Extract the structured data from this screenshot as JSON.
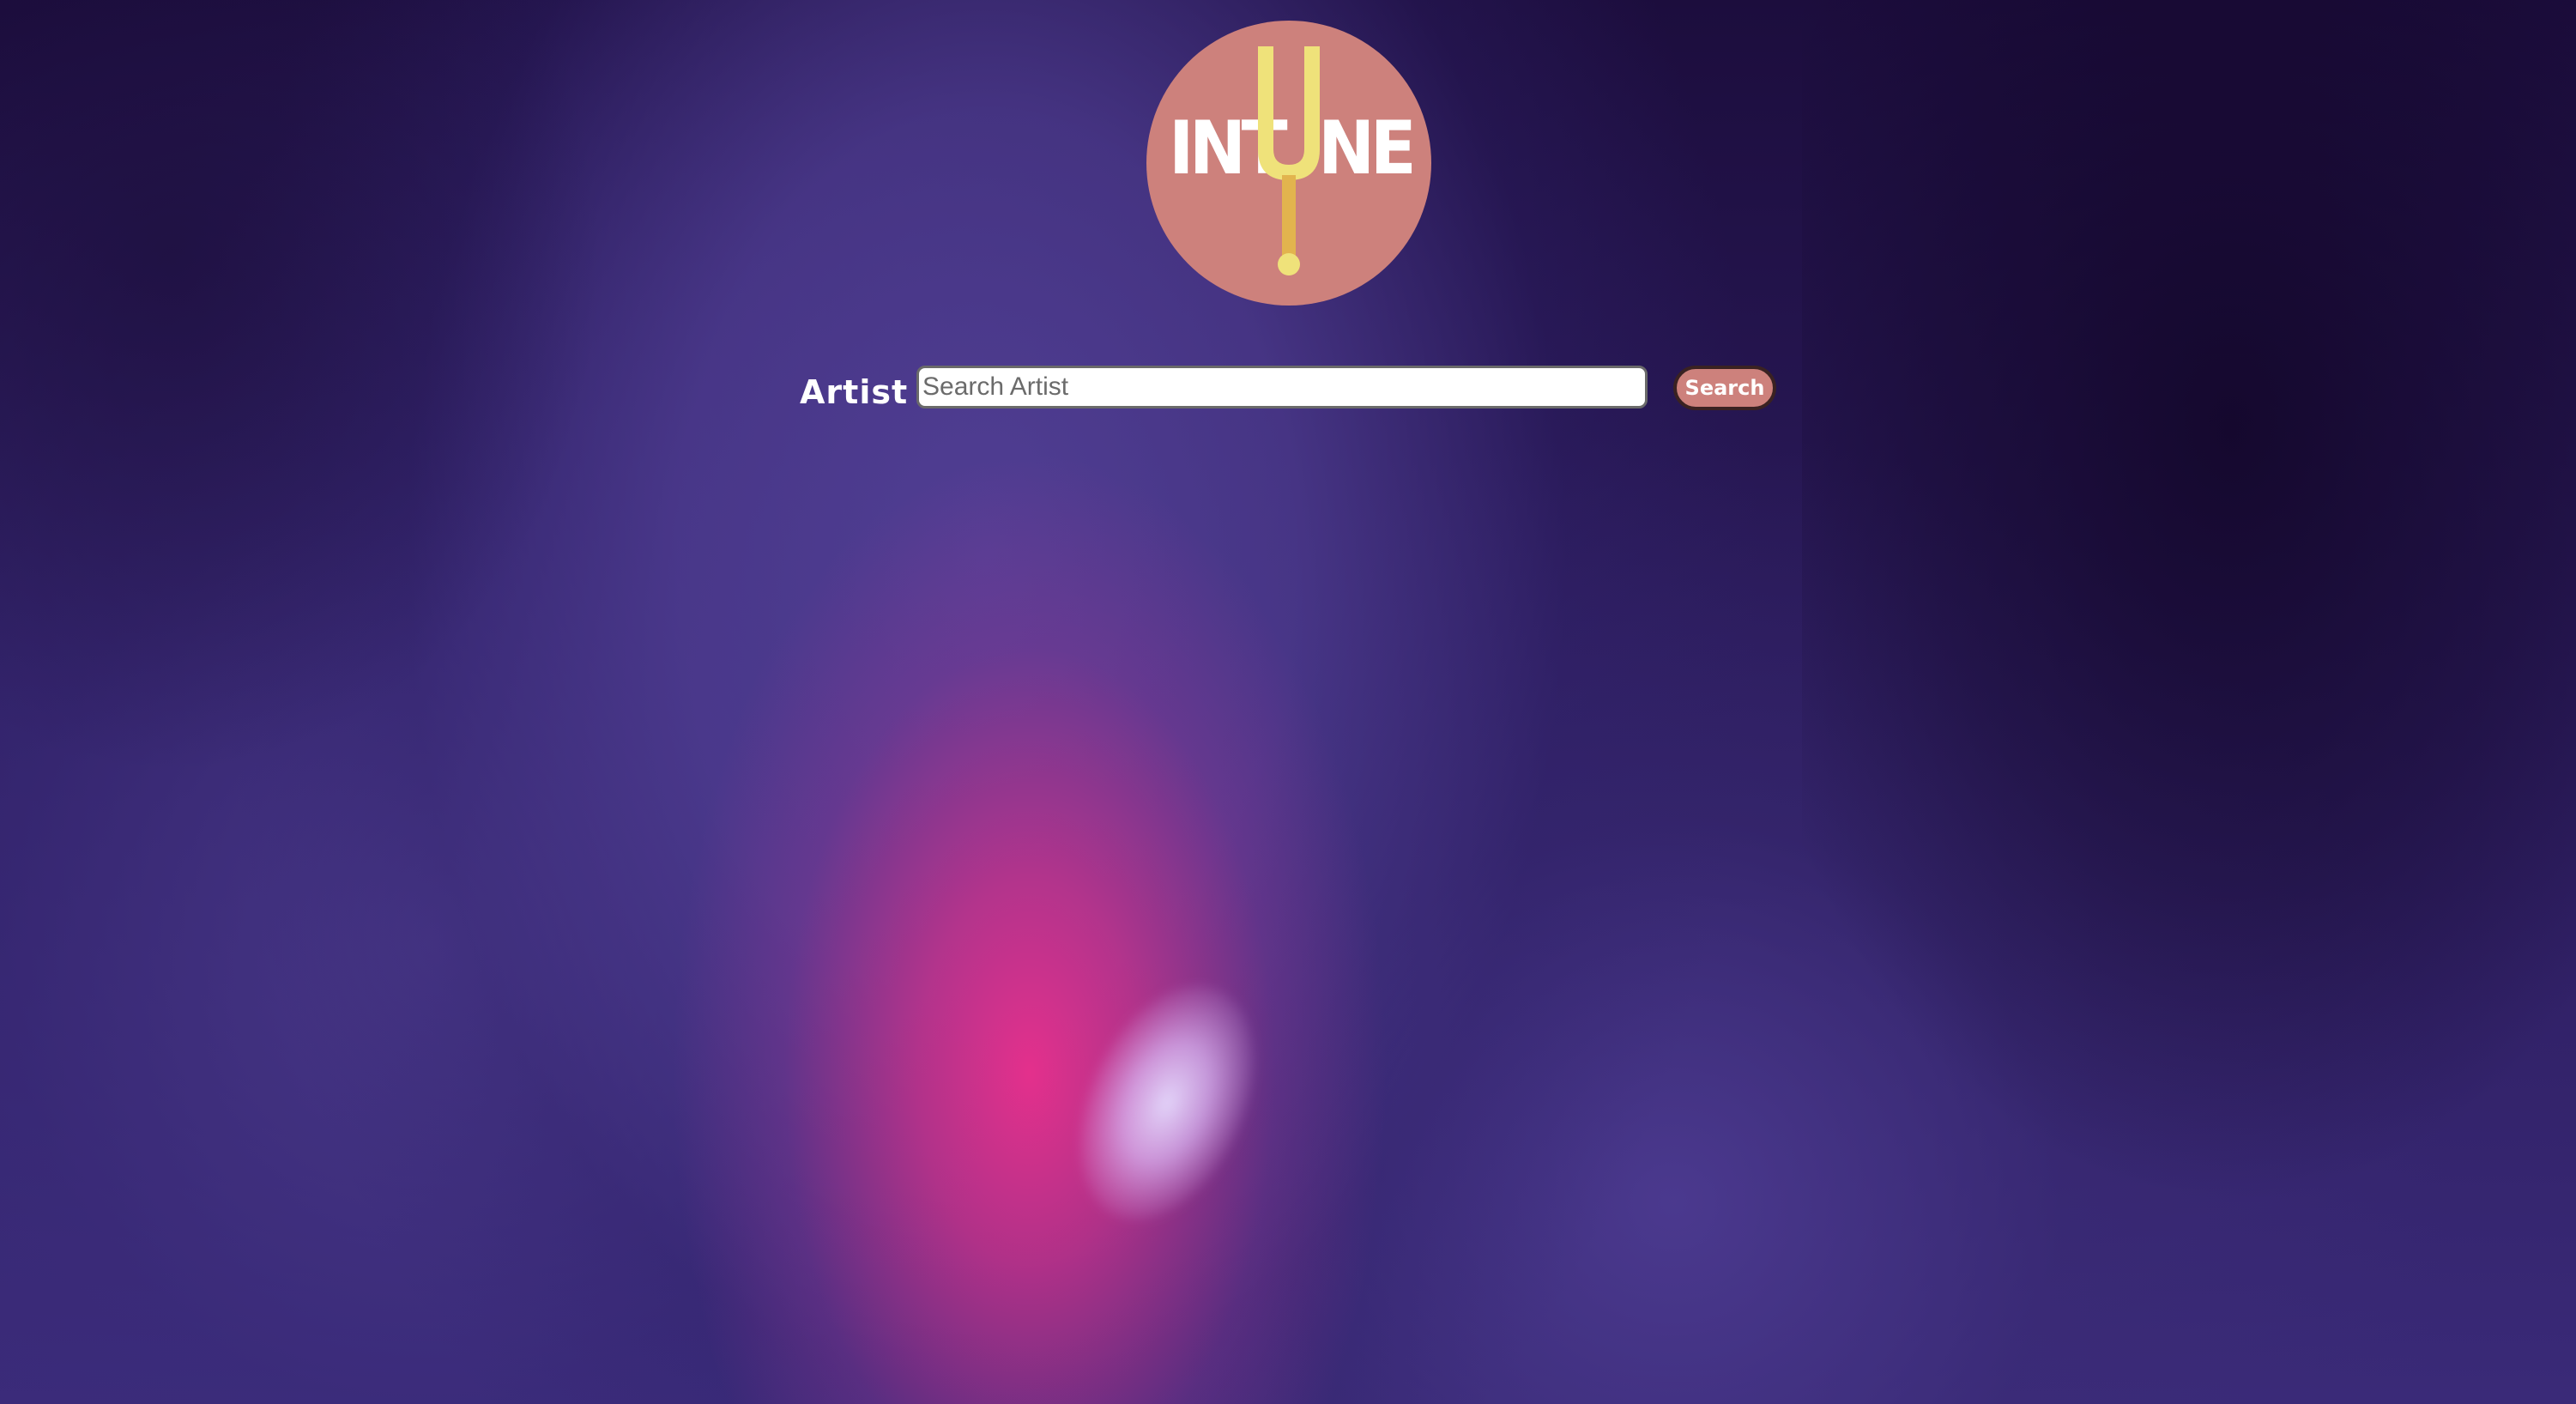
{
  "logo": {
    "text_left": "INT",
    "text_right": "NE",
    "brand_colors": {
      "circle": "#cd817c",
      "fork": "#efe27a",
      "text": "#ffffff"
    },
    "icon": "tuning-fork-icon"
  },
  "search": {
    "label": "Artist",
    "placeholder": "Search Artist",
    "value": "",
    "button_label": "Search"
  },
  "colors": {
    "background_dark": "#170a33",
    "background_purple": "#4f3f8c",
    "background_pink": "#e8348c",
    "accent": "#cd817c"
  }
}
